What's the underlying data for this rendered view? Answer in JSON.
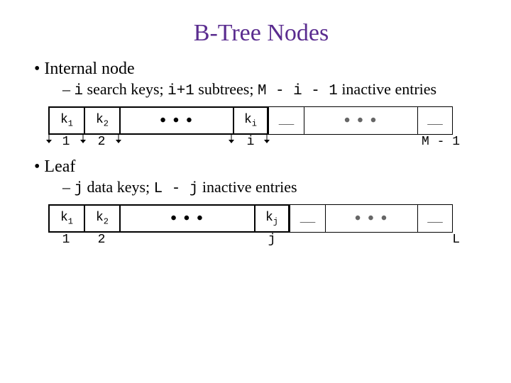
{
  "title": "B-Tree Nodes",
  "internal": {
    "heading": "Internal node",
    "subtext_parts": {
      "p1": "i",
      "p2": " search keys; ",
      "p3": "i+1",
      "p4": " subtrees; ",
      "p5": "M - i - 1",
      "p6": " inactive entries"
    },
    "cells": {
      "k1": "k",
      "s1": "1",
      "k2": "k",
      "s2": "2",
      "dots": "• • •",
      "ki": "k",
      "si": "i",
      "dash1": "__",
      "dots2": "• • •",
      "dash2": "__"
    },
    "labels": {
      "l1": "1",
      "l2": "2",
      "li": "i",
      "lM": "M - 1"
    }
  },
  "leaf": {
    "heading": "Leaf",
    "subtext_parts": {
      "p1": "j",
      "p2": " data keys; ",
      "p3": "L - j",
      "p4": " inactive entries"
    },
    "cells": {
      "k1": "k",
      "s1": "1",
      "k2": "k",
      "s2": "2",
      "dots": "• • •",
      "kj": "k",
      "sj": "j",
      "dash1": "__",
      "dots2": "• • •",
      "dash2": "__"
    },
    "labels": {
      "l1": "1",
      "l2": "2",
      "lj": "j",
      "lL": "L"
    }
  }
}
